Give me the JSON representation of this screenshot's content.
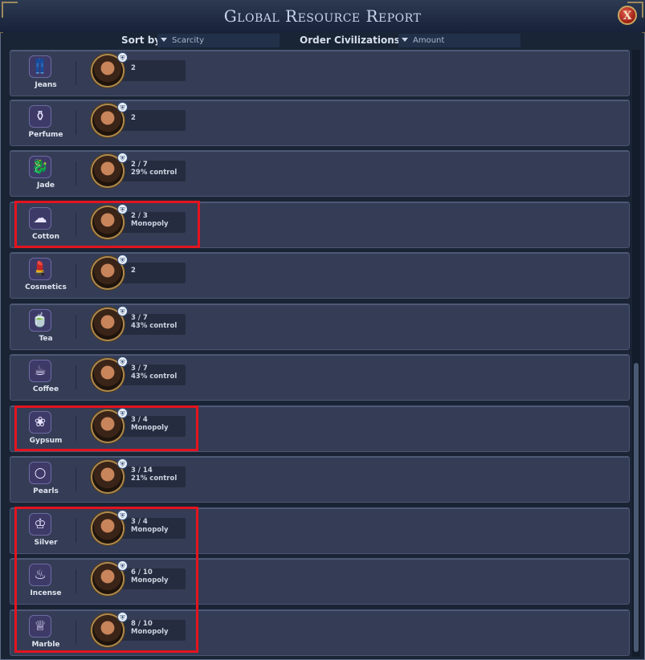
{
  "window": {
    "title": "Global Resource Report",
    "close_label": "X"
  },
  "sort": {
    "sort_by_label": "Sort by",
    "sort_by_value": "Scarcity",
    "order_label": "Order Civilizations by",
    "order_value": "Amount"
  },
  "resources": [
    {
      "name": "Jeans",
      "icon": "jeans-icon",
      "glyph": "👖",
      "line1": "2",
      "line2": ""
    },
    {
      "name": "Perfume",
      "icon": "perfume-icon",
      "glyph": "⚱",
      "line1": "2",
      "line2": ""
    },
    {
      "name": "Jade",
      "icon": "jade-icon",
      "glyph": "🐉",
      "line1": "2 / 7",
      "line2": "29% control"
    },
    {
      "name": "Cotton",
      "icon": "cotton-icon",
      "glyph": "☁",
      "line1": "2 / 3",
      "line2": "Monopoly"
    },
    {
      "name": "Cosmetics",
      "icon": "cosmetics-icon",
      "glyph": "💄",
      "line1": "2",
      "line2": ""
    },
    {
      "name": "Tea",
      "icon": "tea-icon",
      "glyph": "🍵",
      "line1": "3 / 7",
      "line2": "43% control"
    },
    {
      "name": "Coffee",
      "icon": "coffee-icon",
      "glyph": "☕",
      "line1": "3 / 7",
      "line2": "43% control"
    },
    {
      "name": "Gypsum",
      "icon": "gypsum-icon",
      "glyph": "❀",
      "line1": "3 / 4",
      "line2": "Monopoly"
    },
    {
      "name": "Pearls",
      "icon": "pearls-icon",
      "glyph": "○",
      "line1": "3 / 14",
      "line2": "21% control"
    },
    {
      "name": "Silver",
      "icon": "silver-icon",
      "glyph": "♔",
      "line1": "3 / 4",
      "line2": "Monopoly"
    },
    {
      "name": "Incense",
      "icon": "incense-icon",
      "glyph": "♨",
      "line1": "6 / 10",
      "line2": "Monopoly"
    },
    {
      "name": "Marble",
      "icon": "marble-icon",
      "glyph": "♕",
      "line1": "8 / 10",
      "line2": "Monopoly"
    }
  ],
  "colors": {
    "highlight": "#e3141f",
    "row_bg": "#353d56",
    "title_text": "#c9d6e8",
    "portrait_ring": "#b08a4c"
  }
}
